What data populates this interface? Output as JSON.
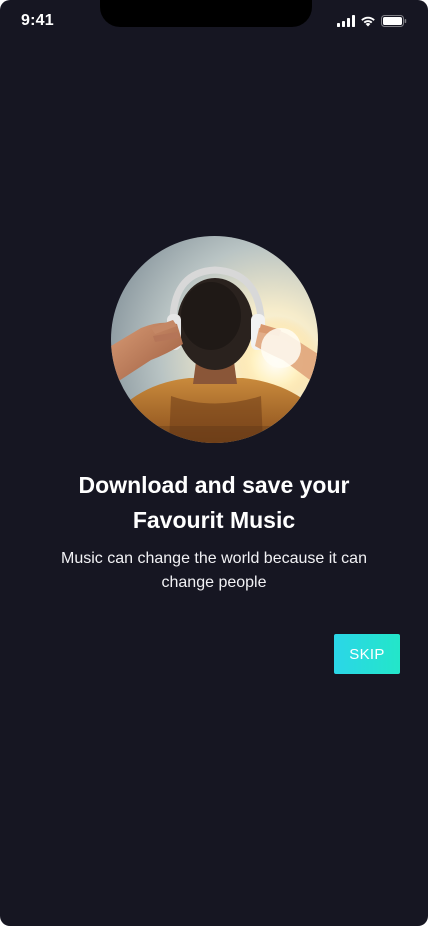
{
  "status_bar": {
    "time": "9:41",
    "icons": [
      "signal-icon",
      "wifi-icon",
      "battery-icon"
    ]
  },
  "onboarding": {
    "image": "person-with-headphones-image",
    "title_line1": "Download and save your",
    "title_line2": "Favourit Music",
    "subtitle_line1": "Music can change the world because it can",
    "subtitle_line2": "change people",
    "skip_label": "SKIP"
  },
  "colors": {
    "background": "#161622",
    "accent_start": "#2bd6e8",
    "accent_end": "#23e6c9",
    "text": "#ffffff"
  }
}
